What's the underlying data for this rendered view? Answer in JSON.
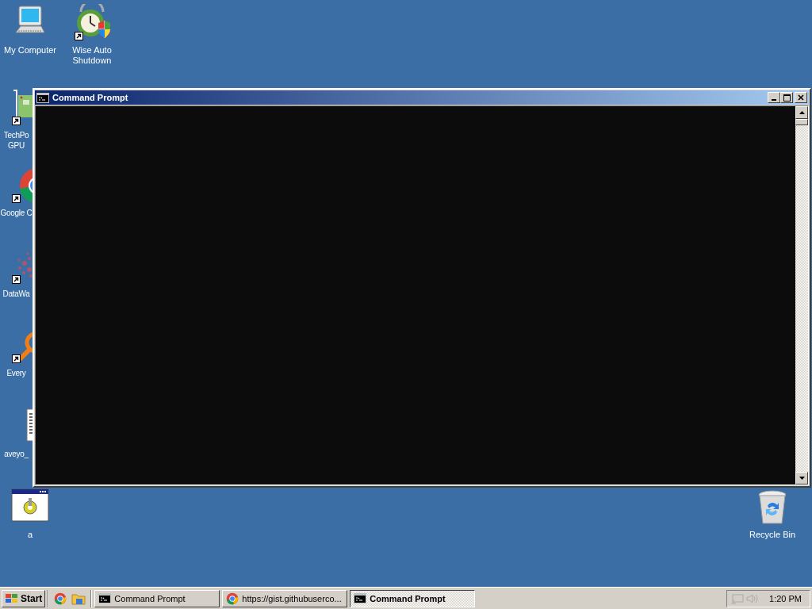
{
  "desktop": {
    "icons": [
      {
        "label": "My Computer",
        "kind": "computer",
        "shortcut": false
      },
      {
        "label": "Wise Auto\nShutdown",
        "kind": "clock",
        "shortcut": true
      },
      {
        "label": "TechPo\nGPU",
        "kind": "board",
        "shortcut": true
      },
      {
        "label": "Google C",
        "kind": "chrome",
        "shortcut": true
      },
      {
        "label": "DataWa",
        "kind": "splash",
        "shortcut": true
      },
      {
        "label": "Every",
        "kind": "magnifier",
        "shortcut": true
      },
      {
        "label": "aveyo_",
        "kind": "document",
        "shortcut": false
      },
      {
        "label": "a",
        "kind": "program",
        "shortcut": false
      },
      {
        "label": "Recycle Bin",
        "kind": "bin",
        "shortcut": false
      }
    ]
  },
  "window": {
    "title": "Command Prompt"
  },
  "taskbar": {
    "start": "Start",
    "quick_launch": [
      {
        "kind": "chrome"
      },
      {
        "kind": "folder"
      }
    ],
    "tasks": [
      {
        "label": "Command Prompt",
        "kind": "cmd",
        "selected": false
      },
      {
        "label": "https://gist.githubuserco...",
        "kind": "chrome",
        "selected": false
      },
      {
        "label": "Command Prompt",
        "kind": "cmd",
        "selected": true
      }
    ],
    "clock": "1:20 PM"
  }
}
